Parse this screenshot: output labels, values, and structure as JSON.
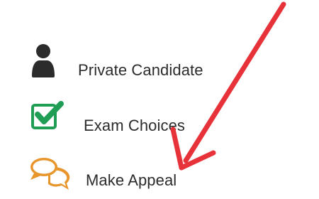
{
  "menu": {
    "items": [
      {
        "label": "Private Candidate",
        "icon": "person-icon",
        "icon_color": "#2b2b2b"
      },
      {
        "label": "Exam Choices",
        "icon": "checkbox-checked-icon",
        "icon_color": "#1f9d55"
      },
      {
        "label": "Make Appeal",
        "icon": "chat-bubbles-icon",
        "icon_color": "#e8952c"
      }
    ]
  },
  "annotation": {
    "icon": "red-arrow-icon",
    "color": "#e8323a"
  }
}
